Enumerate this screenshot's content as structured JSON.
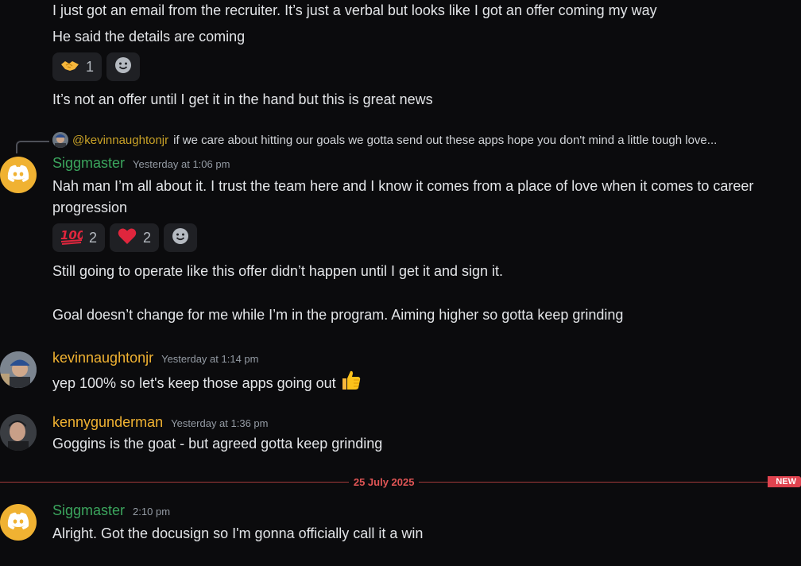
{
  "messages_top": {
    "line1": "I just got an email from the recruiter.  It’s just a verbal but looks like I got an offer coming my way",
    "line2": "He said the details are coming",
    "reaction_handshake_count": "1",
    "line3": "It’s not an offer until I get it in the hand but this is great news"
  },
  "reply": {
    "mention": "@kevinnaughtonjr",
    "preview": "if we care about hitting our goals we gotta send out these apps hope you don't mind a little tough love..."
  },
  "siggmaster_1": {
    "username": "Siggmaster",
    "timestamp": "Yesterday at 1:06 pm",
    "text": "Nah man I’m all about it.  I trust the team here and I know it comes from a place of love when it comes to career progression",
    "reaction_100_count": "2",
    "reaction_heart_count": "2",
    "text2": "Still going to operate like this offer didn’t happen until I get it and sign it.",
    "text3": "Goal doesn’t change for me while I’m in the program.  Aiming higher so gotta keep grinding"
  },
  "kevin": {
    "username": "kevinnaughtonjr",
    "timestamp": "Yesterday at 1:14 pm",
    "text": "yep 100% so let's keep those apps going out"
  },
  "kenny": {
    "username": "kennygunderman",
    "timestamp": "Yesterday at 1:36 pm",
    "text": "Goggins is the goat - but agreed gotta keep grinding"
  },
  "divider": {
    "date": "25 July 2025",
    "new_label": "NEW"
  },
  "siggmaster_2": {
    "username": "Siggmaster",
    "timestamp": "2:10 pm",
    "text": "Alright.  Got the docusign so I'm gonna officially call it a win"
  },
  "colors": {
    "siggmaster": "#3ba55d",
    "kevin": "#f0b232",
    "kenny": "#f0b232",
    "background": "#0b0b0d",
    "new_badge": "#e0434f"
  }
}
